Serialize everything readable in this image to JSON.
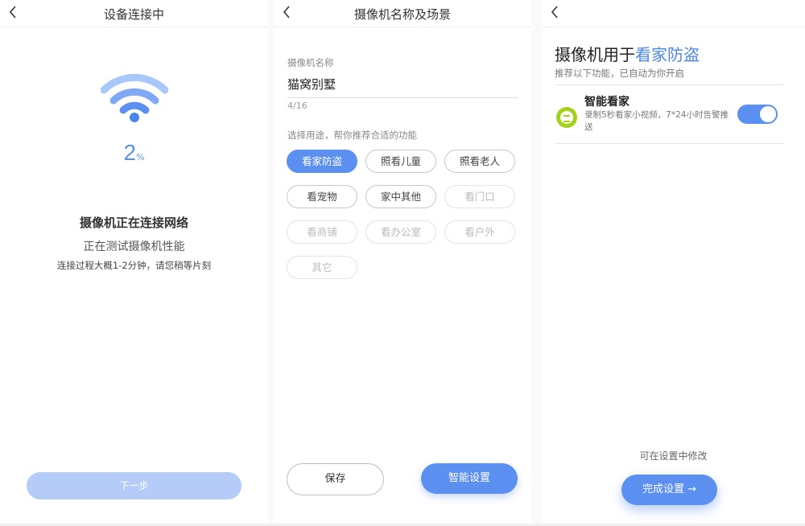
{
  "screen1": {
    "title": "设备连接中",
    "progress_value": "2",
    "progress_unit": "%",
    "heading": "摄像机正在连接网络",
    "subheading": "正在测试摄像机性能",
    "hint": "连接过程大概1-2分钟，请您稍等片刻",
    "next_button": "下一步",
    "icons": {
      "back": "chevron-left-icon",
      "wifi": "wifi-icon"
    }
  },
  "screen2": {
    "title": "摄像机名称及场景",
    "name_label": "摄像机名称",
    "name_value": "猫窝别墅",
    "name_counter": "4/16",
    "usage_label": "选择用途，帮你推荐合适的功能",
    "tags": [
      {
        "label": "看家防盗",
        "state": "active"
      },
      {
        "label": "照看儿童",
        "state": "normal"
      },
      {
        "label": "照看老人",
        "state": "normal"
      },
      {
        "label": "看宠物",
        "state": "normal"
      },
      {
        "label": "家中其他",
        "state": "normal"
      },
      {
        "label": "看门口",
        "state": "disabled"
      },
      {
        "label": "看商铺",
        "state": "disabled"
      },
      {
        "label": "看办公室",
        "state": "disabled"
      },
      {
        "label": "看户外",
        "state": "disabled"
      },
      {
        "label": "其它",
        "state": "disabled"
      }
    ],
    "save_button": "保存",
    "smart_button": "智能设置"
  },
  "screen3": {
    "title_prefix": "摄像机用于",
    "title_highlight": "看家防盗",
    "subtitle": "推荐以下功能，已自动为你开启",
    "feature": {
      "title": "智能看家",
      "description": "录制5秒看家小视频，7*24小时告警推送",
      "enabled": true,
      "icon": "smart-guard-icon"
    },
    "modify_hint": "可在设置中修改",
    "done_button": "完成设置 →"
  },
  "colors": {
    "accent": "#5b8ff0",
    "accent_light": "#b5ccf9",
    "feature_icon": "#a4d21a"
  }
}
